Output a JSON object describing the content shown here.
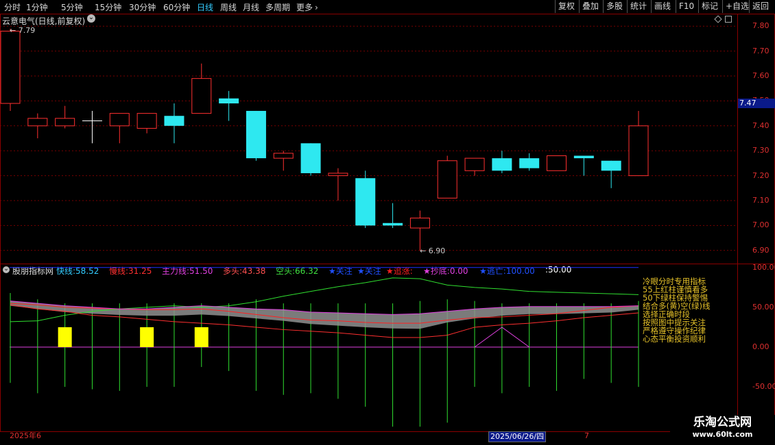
{
  "toolbar": {
    "periods": [
      "分时",
      "1分钟",
      "5分钟",
      "15分钟",
      "30分钟",
      "60分钟",
      "日线",
      "周线",
      "月线",
      "多周期",
      "更多"
    ],
    "more_chevron": "›",
    "actions": [
      "复权",
      "叠加",
      "多股",
      "统计",
      "画线",
      "F10",
      "标记",
      "+自选",
      "返回"
    ]
  },
  "main": {
    "title": "云意电气(日线,前复权)",
    "dropdown_icon": "⌄",
    "high_label": "7.79",
    "low_label": "6.90",
    "price_tag": "7.47",
    "yticks": [
      "7.80",
      "7.70",
      "7.60",
      "7.50",
      "7.40",
      "7.30",
      "7.20",
      "7.10",
      "7.00",
      "6.90"
    ]
  },
  "indicator": {
    "name": "股朋指标网",
    "items": [
      {
        "label": "快线:",
        "value": "58.52",
        "color": "#3cf"
      },
      {
        "label": "慢线:",
        "value": "31.25",
        "color": "#ff3030"
      },
      {
        "label": "主力线:",
        "value": "51.50",
        "color": "#e040e0"
      },
      {
        "label": "多头:",
        "value": "43.38",
        "color": "#ff5050"
      },
      {
        "label": "空头:",
        "value": "66.32",
        "color": "#40e040"
      },
      {
        "label": "★关注",
        "value": "",
        "color": "#2050ff"
      },
      {
        "label": "★关注",
        "value": "",
        "color": "#2050ff"
      },
      {
        "label": "★追涨:",
        "value": "",
        "color": "#ff2020"
      },
      {
        "label": "★抄底:",
        "value": "0.00",
        "color": "#e040e0"
      },
      {
        "label": "★逃亡:",
        "value": "100.00",
        "color": "#2050ff"
      },
      {
        "label": ":",
        "value": "50.00",
        "color": "#ffffff"
      }
    ],
    "yticks": [
      "100.00",
      "50.00",
      "0.00",
      "-50.00"
    ],
    "notes": [
      "冷眼分时专用指标",
      "55上红柱谨慎看多",
      "50下绿柱保持警惕",
      "结合多(黄)空(绿)线",
      "选择正确时段",
      "按照图中提示关注",
      "严格遵守操作纪律",
      "心态平衡投资顺利"
    ]
  },
  "footer": {
    "start_date": "2025年6",
    "cursor_date": "2025/06/26/四",
    "cursor_extra": "7"
  },
  "watermark": {
    "name": "乐淘公式网",
    "url": "www.60lt.com"
  },
  "chart_data": {
    "type": "candlestick",
    "title": "云意电气(日线,前复权)",
    "ylim": [
      6.85,
      7.85
    ],
    "candles": [
      {
        "o": 7.49,
        "h": 7.79,
        "l": 7.46,
        "c": 7.78
      },
      {
        "o": 7.4,
        "h": 7.45,
        "l": 7.35,
        "c": 7.43
      },
      {
        "o": 7.4,
        "h": 7.48,
        "l": 7.39,
        "c": 7.43
      },
      {
        "o": 7.42,
        "h": 7.46,
        "l": 7.33,
        "c": 7.42
      },
      {
        "o": 7.4,
        "h": 7.45,
        "l": 7.33,
        "c": 7.45
      },
      {
        "o": 7.39,
        "h": 7.45,
        "l": 7.37,
        "c": 7.45
      },
      {
        "o": 7.44,
        "h": 7.49,
        "l": 7.33,
        "c": 7.4
      },
      {
        "o": 7.45,
        "h": 7.65,
        "l": 7.45,
        "c": 7.59
      },
      {
        "o": 7.51,
        "h": 7.54,
        "l": 7.42,
        "c": 7.49
      },
      {
        "o": 7.46,
        "h": 7.46,
        "l": 7.26,
        "c": 7.27
      },
      {
        "o": 7.27,
        "h": 7.3,
        "l": 7.22,
        "c": 7.29
      },
      {
        "o": 7.33,
        "h": 7.33,
        "l": 7.2,
        "c": 7.21
      },
      {
        "o": 7.2,
        "h": 7.23,
        "l": 7.1,
        "c": 7.21
      },
      {
        "o": 7.19,
        "h": 7.22,
        "l": 6.99,
        "c": 7.0
      },
      {
        "o": 7.01,
        "h": 7.09,
        "l": 6.99,
        "c": 7.0
      },
      {
        "o": 6.99,
        "h": 7.06,
        "l": 6.9,
        "c": 7.03
      },
      {
        "o": 7.11,
        "h": 7.28,
        "l": 7.11,
        "c": 7.26
      },
      {
        "o": 7.22,
        "h": 7.27,
        "l": 7.2,
        "c": 7.27
      },
      {
        "o": 7.27,
        "h": 7.3,
        "l": 7.21,
        "c": 7.22
      },
      {
        "o": 7.27,
        "h": 7.29,
        "l": 7.22,
        "c": 7.23
      },
      {
        "o": 7.22,
        "h": 7.28,
        "l": 7.22,
        "c": 7.28
      },
      {
        "o": 7.28,
        "h": 7.28,
        "l": 7.2,
        "c": 7.27
      },
      {
        "o": 7.26,
        "h": 7.26,
        "l": 7.15,
        "c": 7.22
      },
      {
        "o": 7.2,
        "h": 7.46,
        "l": 7.2,
        "c": 7.4
      }
    ],
    "indicator": {
      "ylim": [
        -105,
        105
      ],
      "fast": [
        62,
        57,
        52,
        50,
        49,
        47,
        45,
        46,
        44,
        40,
        35,
        30,
        27,
        24,
        22,
        20,
        33,
        40,
        45,
        48,
        48,
        50,
        52,
        58
      ],
      "slow": [
        55,
        53,
        50,
        49,
        48,
        47,
        47,
        48,
        45,
        41,
        37,
        34,
        33,
        31,
        30,
        30,
        34,
        37,
        38,
        40,
        42,
        46,
        50,
        52
      ],
      "main": [
        58,
        55,
        52,
        50,
        48,
        48,
        50,
        52,
        50,
        48,
        47,
        44,
        43,
        42,
        41,
        42,
        45,
        48,
        50,
        51,
        51,
        51,
        51,
        52
      ],
      "bull": [
        53,
        48,
        45,
        40,
        38,
        35,
        32,
        30,
        28,
        25,
        22,
        20,
        18,
        15,
        12,
        12,
        15,
        25,
        28,
        30,
        33,
        37,
        40,
        43
      ],
      "bear": [
        32,
        33,
        40,
        45,
        48,
        50,
        52,
        50,
        52,
        57,
        64,
        70,
        76,
        81,
        87,
        86,
        78,
        75,
        73,
        70,
        69,
        68,
        67,
        66
      ],
      "pink": [
        null,
        null,
        null,
        null,
        null,
        null,
        null,
        null,
        null,
        null,
        null,
        null,
        null,
        null,
        null,
        null,
        null,
        0,
        50,
        0,
        null,
        null,
        null,
        null
      ],
      "bars": [
        -45,
        -58,
        -50,
        -53,
        -55,
        -50,
        -50,
        -25,
        -30,
        -55,
        -60,
        -58,
        -65,
        -75,
        -100,
        -100,
        -95,
        -50,
        -58,
        -50,
        -55,
        -40,
        -45,
        -50
      ],
      "bars_top": [
        68,
        60,
        55,
        55,
        55,
        55,
        55,
        55,
        55,
        60,
        55,
        55,
        55,
        55,
        55,
        58,
        60,
        58,
        55,
        55,
        55,
        55,
        55,
        58
      ],
      "yellow_bars": [
        2,
        5,
        7
      ]
    }
  }
}
